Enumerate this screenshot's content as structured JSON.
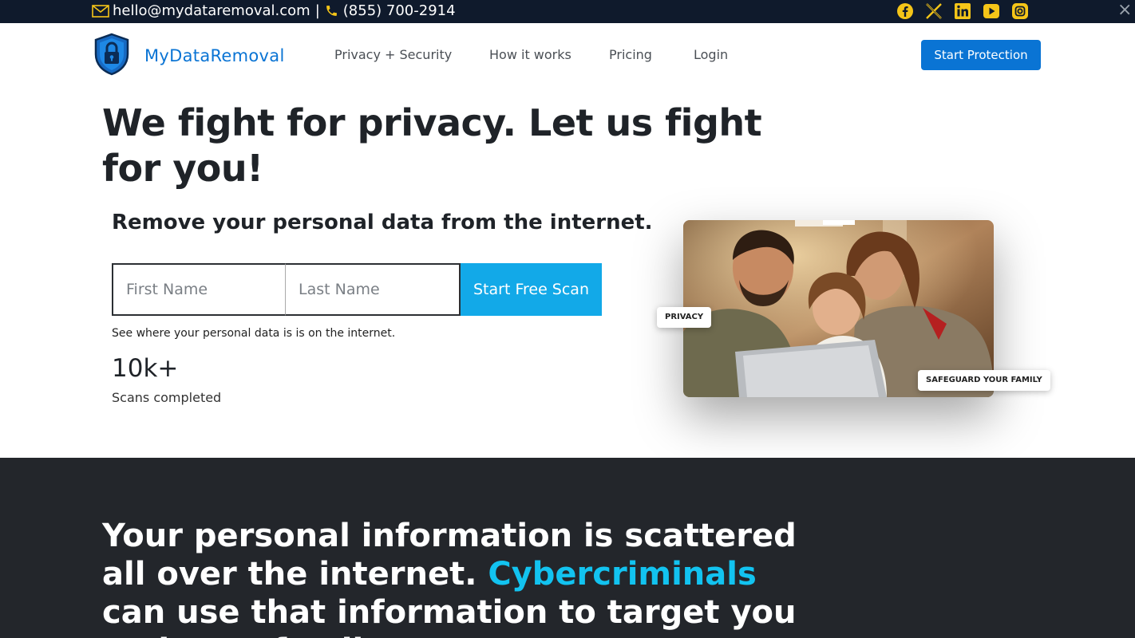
{
  "topbar": {
    "email": "hello@mydataremoval.com",
    "separator": "|",
    "phone": "(855) 700-2914",
    "socials": [
      "facebook-icon",
      "x-icon",
      "linkedin-icon",
      "youtube-icon",
      "instagram-icon"
    ],
    "close_label": "×"
  },
  "nav": {
    "brand": "MyDataRemoval",
    "links": [
      "Privacy + Security",
      "How it works",
      "Pricing",
      "Login"
    ],
    "cta": "Start Protection"
  },
  "hero": {
    "title": "We fight for privacy. Let us fight for you!",
    "subhead": "Remove your personal data from the internet.",
    "first_name_placeholder": "First Name",
    "last_name_placeholder": "Last Name",
    "scan_button": "Start Free Scan",
    "hint": "See where your personal data is is on the internet.",
    "stat_value": "10k+",
    "stat_label": "Scans completed",
    "tag_privacy": "PRIVACY",
    "tag_family": "SAFEGUARD YOUR FAMILY"
  },
  "section2": {
    "text_before": "Your personal information is scattered all over the internet. ",
    "accent": "Cybercriminals",
    "text_after": " can use that information to target you and your family."
  },
  "colors": {
    "topbar_bg": "#0f1a2c",
    "brand_blue": "#0a74d4",
    "scan_button": "#12a9e8",
    "accent_cyan": "#12c3f0",
    "icon_yellow": "#f5c518",
    "dark_bg": "#23262b"
  }
}
